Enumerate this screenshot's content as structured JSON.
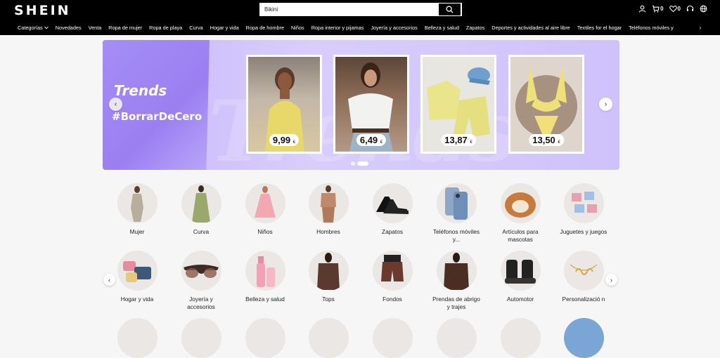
{
  "header": {
    "logo": "SHEIN",
    "search_value": "Bikini",
    "cart_count": "0",
    "wishlist_count": "0"
  },
  "nav": {
    "items": [
      "Categorías",
      "Novedades",
      "Venta",
      "Ropa de mujer",
      "Ropa de playa",
      "Curva",
      "Hogar y vida",
      "Ropa de hombre",
      "Niños",
      "Ropa interior y pijamas",
      "Joyería y accesorios",
      "Belleza y salud",
      "Zapatos",
      "Deportes y actividades al aire libre",
      "Textiles for el hogar",
      "Teléfonos móviles y"
    ],
    "dropdown_icon": "chevron-down-icon"
  },
  "banner": {
    "brand": "Trends",
    "hashtag": "#BorrarDeCero",
    "watermark": "Trends",
    "products": [
      {
        "price": "9,99",
        "currency": "€"
      },
      {
        "price": "6,49",
        "currency": "€"
      },
      {
        "price": "13,87",
        "currency": "€"
      },
      {
        "price": "13,50",
        "currency": "€"
      }
    ],
    "colors": {
      "accent": "#9b7ff2",
      "background": "#d8cdfd"
    }
  },
  "categories": {
    "row1": [
      "Mujer",
      "Curva",
      "Niños",
      "Hombres",
      "Zapatos",
      "Teléfonos móviles y...",
      "Artículos para mascotas",
      "Juguetes y juegos"
    ],
    "row2": [
      "Hogar y vida",
      "Joyería y accesorios",
      "Belleza y salud",
      "Tops",
      "Fondos",
      "Prendas de abrigo y trajes",
      "Automotor",
      "Personalizació n"
    ]
  }
}
